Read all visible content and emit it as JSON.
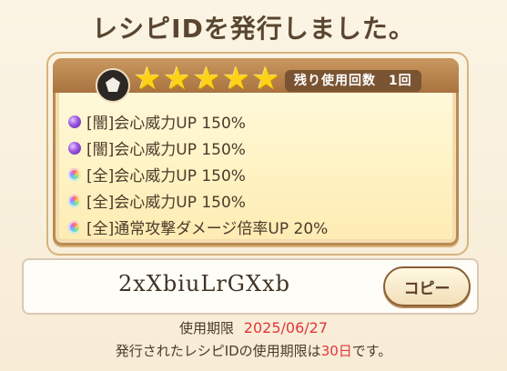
{
  "title": "レシピIDを発行しました。",
  "card": {
    "emblem_icon": "crest-icon",
    "stars": [
      "★",
      "★",
      "★",
      "★",
      "★"
    ],
    "rating": 5,
    "uses_label": "残り使用回数",
    "uses_value": "1回",
    "skills": [
      {
        "type": "dark",
        "text": "[闇]会心威力UP 150%"
      },
      {
        "type": "dark",
        "text": "[闇]会心威力UP 150%"
      },
      {
        "type": "all",
        "text": "[全]会心威力UP 150%"
      },
      {
        "type": "all",
        "text": "[全]会心威力UP 150%"
      },
      {
        "type": "all",
        "text": "[全]通常攻撃ダメージ倍率UP 20%"
      }
    ]
  },
  "code": {
    "value": "2xXbiuLrGXxb",
    "copy_label": "コピー"
  },
  "expiry": {
    "label": "使用期限",
    "date": "2025/06/27"
  },
  "note": {
    "prefix": "発行されたレシピIDの使用期限は",
    "days": "30日",
    "suffix": "です。"
  },
  "colors": {
    "accent_red": "#e2373b",
    "star_gold": "#ffd21a",
    "frame_brown": "#b98a52"
  }
}
